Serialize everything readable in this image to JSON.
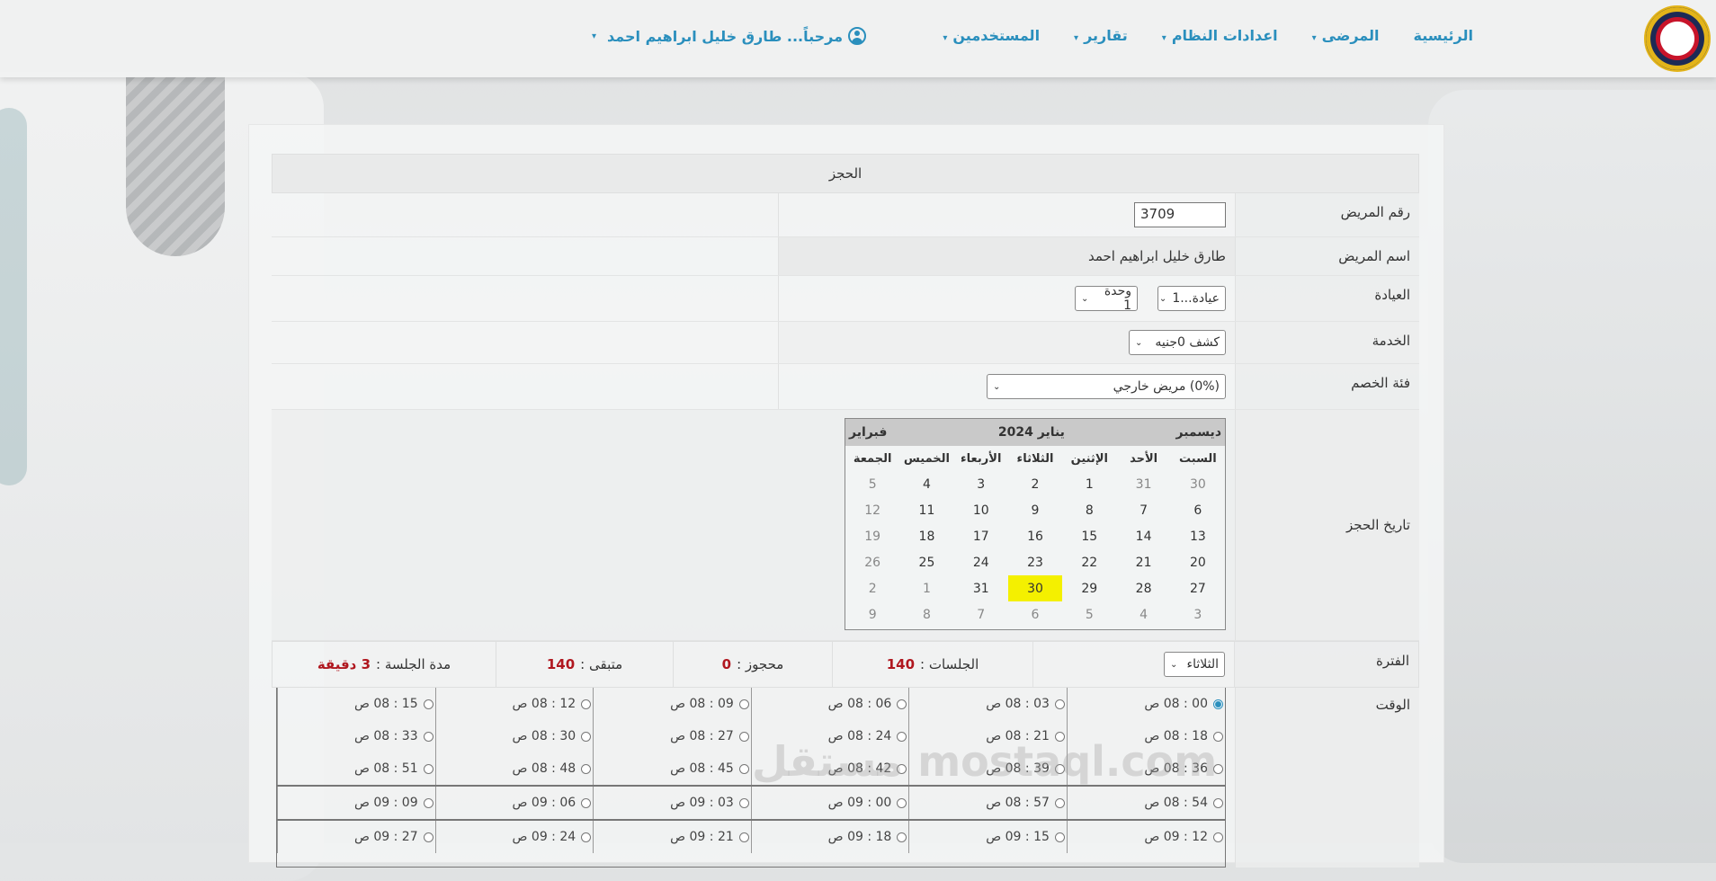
{
  "nav": {
    "items": [
      {
        "label": "الرئيسية",
        "caret": false
      },
      {
        "label": "المرضى",
        "caret": true
      },
      {
        "label": "اعدادات النظام",
        "caret": true
      },
      {
        "label": "تقارير",
        "caret": true
      },
      {
        "label": "المستخدمين",
        "caret": true
      }
    ],
    "welcome": "مرحباً... طارق خليل ابراهيم احمد"
  },
  "form": {
    "header": "الحجز",
    "patient_no_label": "رقم المريض",
    "patient_no": "3709",
    "patient_name_label": "اسم المريض",
    "patient_name": "طارق خليل ابراهيم احمد",
    "clinic_label": "العيادة",
    "clinic_value": "عيادة...1",
    "unit_value": "وحدة 1",
    "service_label": "الخدمة",
    "service_value": "كشف 0جنيه",
    "discount_label": "فئة الخصم",
    "discount_value": "(0%) مريض خارجي",
    "date_label": "تاريخ الحجز",
    "period_label": "الفترة",
    "period_value": "الثلاثاء",
    "time_label": "الوقت"
  },
  "calendar": {
    "prev": "ديسمبر",
    "current": "يناير 2024",
    "next": "فبراير",
    "day_names": [
      "السبت",
      "الأحد",
      "الإثنين",
      "الثلاثاء",
      "الأربعاء",
      "الخميس",
      "الجمعة"
    ],
    "weeks": [
      [
        "30",
        "31",
        "1",
        "2",
        "3",
        "4",
        "5"
      ],
      [
        "6",
        "7",
        "8",
        "9",
        "10",
        "11",
        "12"
      ],
      [
        "13",
        "14",
        "15",
        "16",
        "17",
        "18",
        "19"
      ],
      [
        "20",
        "21",
        "22",
        "23",
        "24",
        "25",
        "26"
      ],
      [
        "27",
        "28",
        "29",
        "30",
        "31",
        "1",
        "2"
      ],
      [
        "3",
        "4",
        "5",
        "6",
        "7",
        "8",
        "9"
      ]
    ],
    "selected": "30"
  },
  "stats": {
    "sessions_label": "الجلسات :",
    "sessions": "140",
    "booked_label": "محجوز :",
    "booked": "0",
    "remaining_label": "متبقى :",
    "remaining": "140",
    "duration_label": "مدة الجلسة :",
    "duration": "3 دقيقة"
  },
  "slots": [
    [
      "00 : 08 ص",
      "03 : 08 ص",
      "06 : 08 ص",
      "09 : 08 ص",
      "12 : 08 ص",
      "15 : 08 ص"
    ],
    [
      "18 : 08 ص",
      "21 : 08 ص",
      "24 : 08 ص",
      "27 : 08 ص",
      "30 : 08 ص",
      "33 : 08 ص"
    ],
    [
      "36 : 08 ص",
      "39 : 08 ص",
      "42 : 08 ص",
      "45 : 08 ص",
      "48 : 08 ص",
      "51 : 08 ص"
    ],
    [
      "54 : 08 ص",
      "57 : 08 ص",
      "00 : 09 ص",
      "03 : 09 ص",
      "06 : 09 ص",
      "09 : 09 ص"
    ],
    [
      "12 : 09 ص",
      "15 : 09 ص",
      "18 : 09 ص",
      "21 : 09 ص",
      "24 : 09 ص",
      "27 : 09 ص"
    ]
  ],
  "selected_slot": "00 : 08 ص",
  "watermark": "مستقل mostaql.com",
  "colors": {
    "nav_link": "#2a8fbd",
    "stat_value": "#b0171f",
    "today": "#f4f000"
  }
}
